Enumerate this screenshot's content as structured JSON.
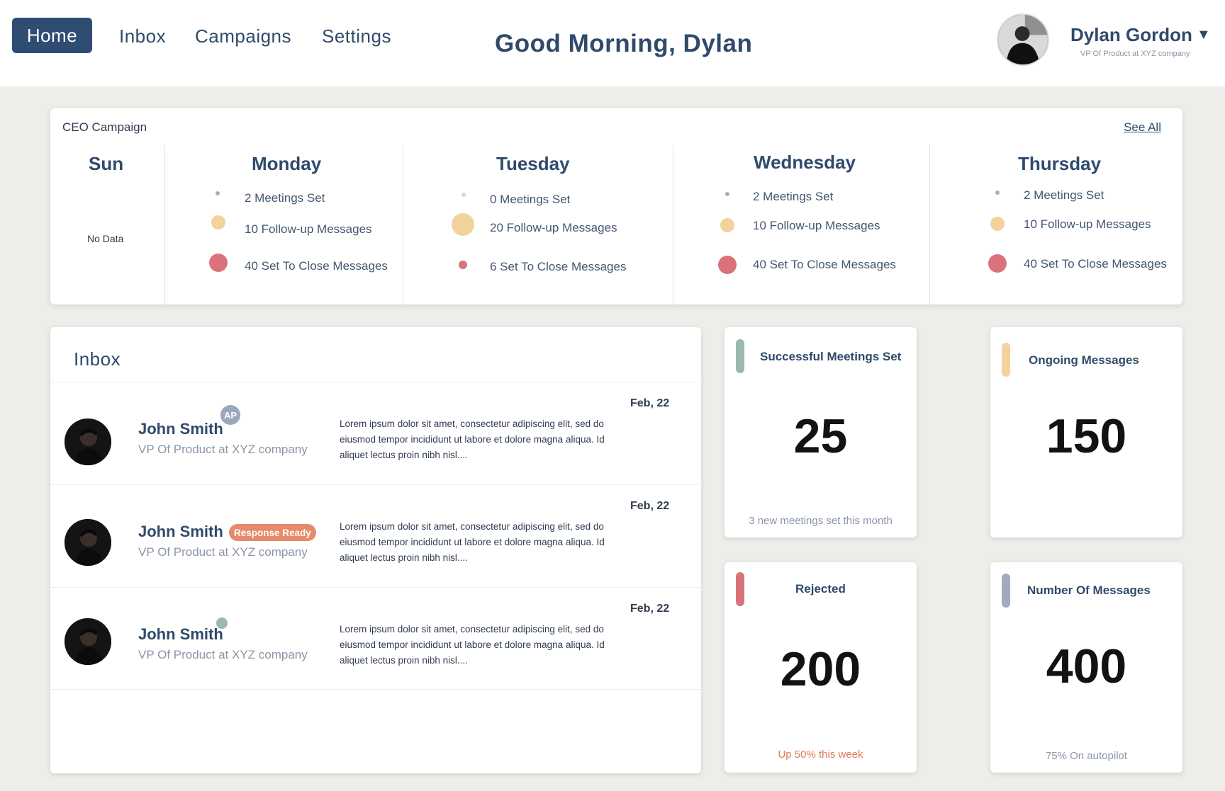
{
  "nav": {
    "home": "Home",
    "inbox": "Inbox",
    "campaigns": "Campaigns",
    "settings": "Settings"
  },
  "greeting": "Good Morning, Dylan",
  "user": {
    "name": "Dylan Gordon",
    "title": "VP Of Product at XYZ company"
  },
  "campaign": {
    "title": "CEO Campaign",
    "see_all": "See All",
    "days": [
      {
        "name": "Sun",
        "no_data": "No Data"
      },
      {
        "name": "Monday",
        "meetings": "2 Meetings Set",
        "followups": "10 Follow-up Messages",
        "close": "40 Set To Close Messages"
      },
      {
        "name": "Tuesday",
        "meetings": "0 Meetings Set",
        "followups": "20 Follow-up Messages",
        "close": "6 Set To Close Messages"
      },
      {
        "name": "Wednesday",
        "meetings": "2 Meetings Set",
        "followups": "10 Follow-up Messages",
        "close": "40 Set To Close Messages"
      },
      {
        "name": "Thursday",
        "meetings": "2 Meetings Set",
        "followups": "10 Follow-up Messages",
        "close": "40 Set To Close Messages"
      }
    ]
  },
  "inbox": {
    "title": "Inbox",
    "rows": [
      {
        "name": "John Smith",
        "role": "VP Of Product at XYZ company",
        "date": "Feb, 22",
        "badge": "AP",
        "message": "Lorem ipsum dolor sit amet, consectetur adipiscing elit, sed do eiusmod tempor incididunt ut labore et dolore magna aliqua. Id aliquet lectus proin nibh nisl...."
      },
      {
        "name": "John Smith",
        "role": "VP Of Product at XYZ company",
        "date": "Feb, 22",
        "badge": "Response Ready",
        "message": "Lorem ipsum dolor sit amet, consectetur adipiscing elit, sed do eiusmod tempor incididunt ut labore et dolore magna aliqua. Id aliquet lectus proin nibh nisl...."
      },
      {
        "name": "John Smith",
        "role": "VP Of Product at XYZ company",
        "date": "Feb, 22",
        "message": "Lorem ipsum dolor sit amet, consectetur adipiscing elit, sed do eiusmod tempor incididunt ut labore et dolore magna aliqua. Id aliquet lectus proin nibh nisl...."
      }
    ]
  },
  "stats": {
    "meetings": {
      "title": "Successful Meetings Set",
      "value": "25",
      "foot": "3 new meetings set this month",
      "color": "#9bb8ad"
    },
    "ongoing": {
      "title": "Ongoing Messages",
      "value": "150",
      "color": "#f2d39c"
    },
    "rejected": {
      "title": "Rejected",
      "value": "200",
      "foot": "Up 50% this week",
      "color": "#d9727b",
      "foot_color": "#e07a54"
    },
    "messages": {
      "title": "Number Of Messages",
      "value": "400",
      "foot": "75% On autopilot",
      "color": "#a0abc2"
    }
  }
}
